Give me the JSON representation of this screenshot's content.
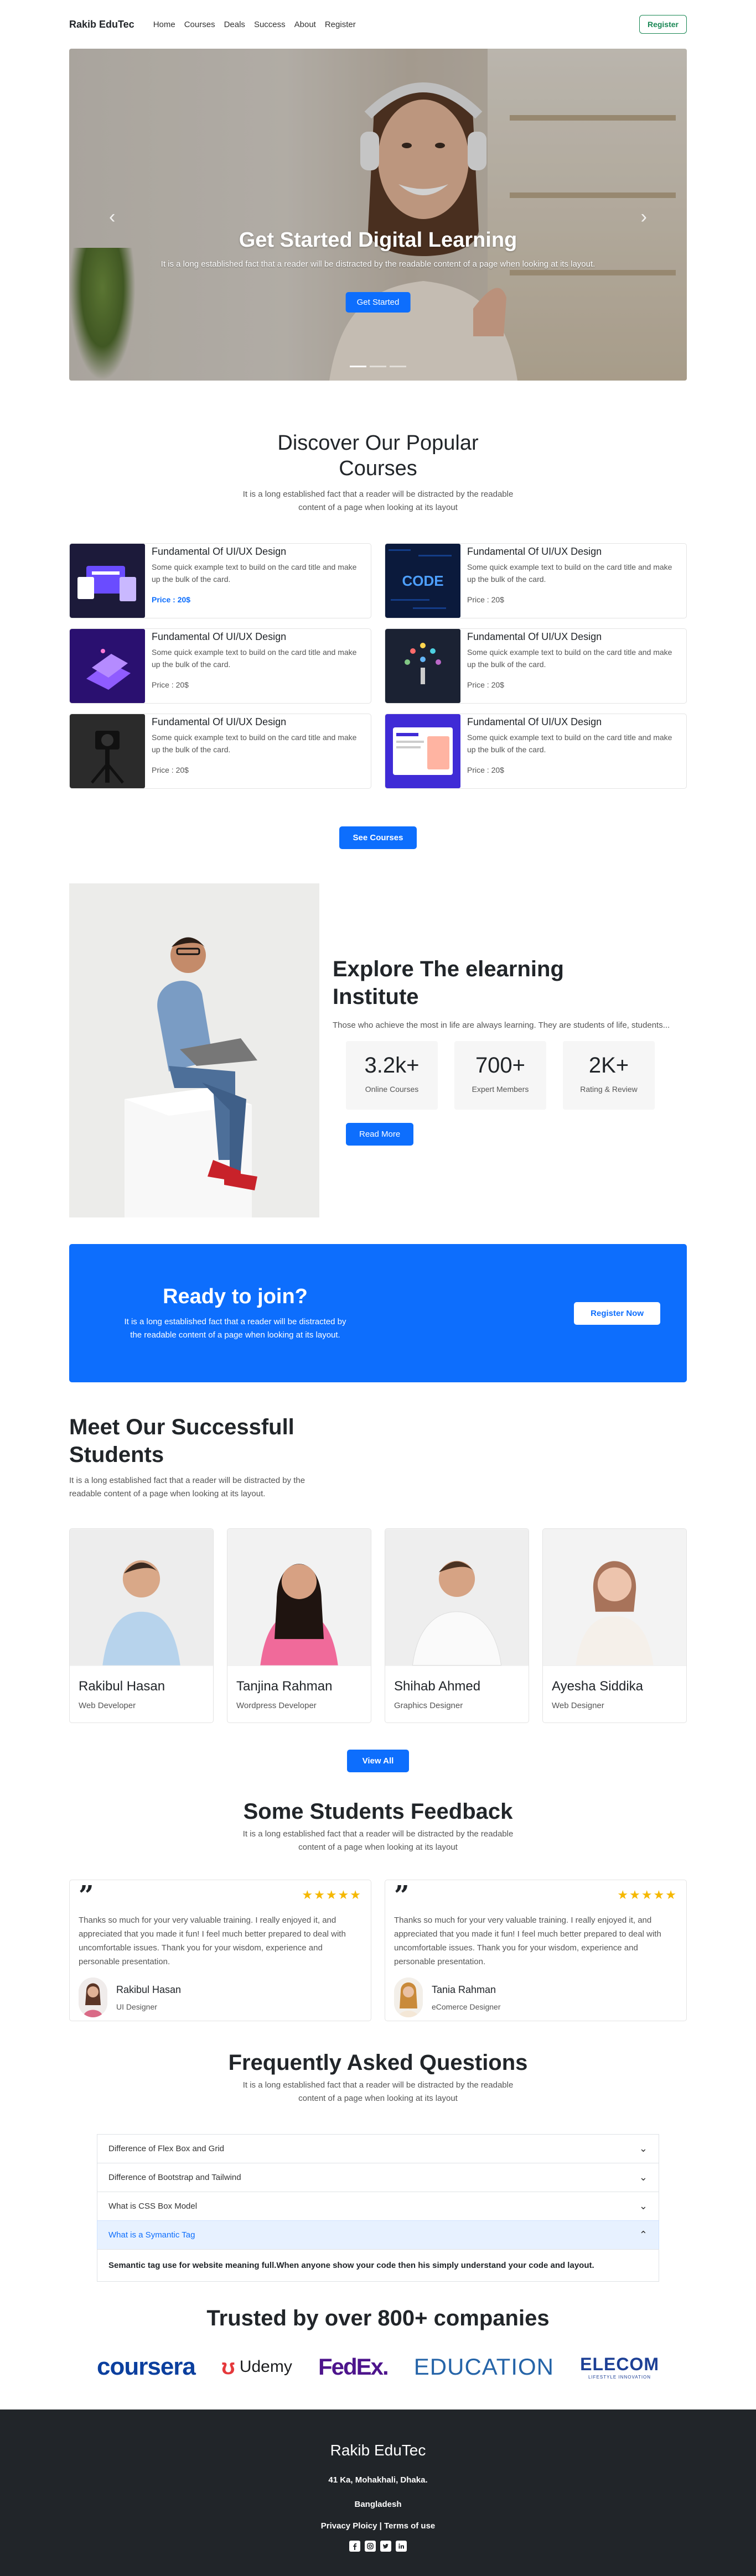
{
  "nav": {
    "brand": "Rakib EduTec",
    "links": [
      "Home",
      "Courses",
      "Deals",
      "Success",
      "About",
      "Register"
    ],
    "register_button": "Register"
  },
  "hero": {
    "title": "Get Started Digital Learning",
    "text": "It is a long established fact that a reader will be distracted by the readable content of a page when looking at its layout.",
    "button": "Get Started",
    "prev_icon": "chevron-left-icon",
    "next_icon": "chevron-right-icon"
  },
  "courses": {
    "title": "Discover Our Popular Courses",
    "subtitle": "It is a long established fact that a reader will be distracted by the readable content of a page when looking at its layout",
    "items": [
      {
        "title": "Fundamental Of UI/UX Design",
        "text": "Some quick example text to build on the card title and make up the bulk of the card.",
        "price": "Price : 20$"
      },
      {
        "title": "Fundamental Of UI/UX Design",
        "text": "Some quick example text to build on the card title and make up the bulk of the card.",
        "price": "Price : 20$",
        "thumb_text": "CODE"
      },
      {
        "title": "Fundamental Of UI/UX Design",
        "text": "Some quick example text to build on the card title and make up the bulk of the card.",
        "price": "Price : 20$"
      },
      {
        "title": "Fundamental Of UI/UX Design",
        "text": "Some quick example text to build on the card title and make up the bulk of the card.",
        "price": "Price : 20$"
      },
      {
        "title": "Fundamental Of UI/UX Design",
        "text": "Some quick example text to build on the card title and make up the bulk of the card.",
        "price": "Price : 20$"
      },
      {
        "title": "Fundamental Of UI/UX Design",
        "text": "Some quick example text to build on the card title and make up the bulk of the card.",
        "price": "Price : 20$"
      }
    ],
    "button": "See Courses"
  },
  "explore": {
    "title": "Explore The elearning Institute",
    "lead": "Those who achieve the most in life are always learning. They are students of life, students...",
    "stats": [
      {
        "value": "3.2k+",
        "label": "Online Courses"
      },
      {
        "value": "700+",
        "label": "Expert Members"
      },
      {
        "value": "2K+",
        "label": "Rating & Review"
      }
    ],
    "button": "Read More"
  },
  "cta": {
    "title": "Ready to join?",
    "text": "It is a long established fact that a reader will be distracted by the readable content of a page when looking at its layout.",
    "button": "Register Now"
  },
  "students": {
    "title": "Meet Our Successfull Students",
    "subtitle": "It is a long established fact that a reader will be distracted by the readable content of a page when looking at its layout.",
    "items": [
      {
        "name": "Rakibul Hasan",
        "role": "Web Developer"
      },
      {
        "name": "Tanjina Rahman",
        "role": "Wordpress Developer"
      },
      {
        "name": "Shihab Ahmed",
        "role": "Graphics Designer"
      },
      {
        "name": "Ayesha Siddika",
        "role": "Web Designer"
      }
    ],
    "button": "View All"
  },
  "feedback": {
    "title": "Some Students Feedback",
    "subtitle": "It is a long established fact that a reader will be distracted by the readable content of a page when looking at its layout",
    "items": [
      {
        "text": "Thanks so much for your very valuable training. I really enjoyed it, and appreciated that you made it fun! I feel much better prepared to deal with uncomfortable issues. Thank you for your wisdom, experience and personable presentation.",
        "name": "Rakibul Hasan",
        "role": "UI Designer",
        "rating": 5
      },
      {
        "text": "Thanks so much for your very valuable training. I really enjoyed it, and appreciated that you made it fun! I feel much better prepared to deal with uncomfortable issues. Thank you for your wisdom, experience and personable presentation.",
        "name": "Tania Rahman",
        "role": "eComerce Designer",
        "rating": 5
      }
    ]
  },
  "faq": {
    "title": "Frequently Asked Questions",
    "subtitle": "It is a long established fact that a reader will be distracted by the readable content of a page when looking at its layout",
    "items": [
      {
        "q": "Difference of Flex Box and Grid"
      },
      {
        "q": "Difference of Bootstrap and Tailwind"
      },
      {
        "q": "What is CSS Box Model"
      },
      {
        "q": "What is a Symantic Tag"
      }
    ],
    "open_answer": "Semantic tag use for website meaning full.When anyone show your code then his simply understand your code and layout."
  },
  "trusted": {
    "title": "Trusted by over 800+ companies",
    "logos": [
      "coursera",
      "Udemy",
      "FedEx.",
      "EDUCATION",
      "ELECOM"
    ],
    "elecom_tagline": "LIFESTYLE INNOVATION"
  },
  "footer": {
    "brand": "Rakib EduTec",
    "address1": "41 Ka, Mohakhali, Dhaka.",
    "address2": "Bangladesh",
    "links": "Privacy Ploicy | Terms of use",
    "social": [
      "facebook-icon",
      "instagram-icon",
      "twitter-icon",
      "linkedin-icon"
    ]
  },
  "colors": {
    "primary": "#0d6efd",
    "success": "#198754",
    "dark": "#212529",
    "star": "#f5b800"
  }
}
